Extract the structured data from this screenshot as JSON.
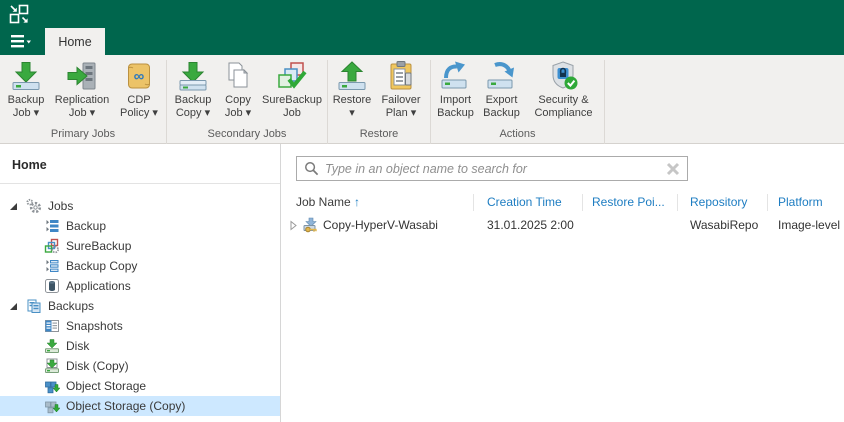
{
  "titlebar": {
    "logo_icon": "veeam-console-logo"
  },
  "tabs": {
    "menu_icon": "hamburger-menu-icon",
    "active_tab": "Home"
  },
  "ribbon": {
    "groups": [
      {
        "label": "Primary Jobs",
        "buttons": [
          {
            "icon": "backup-job-icon",
            "line1": "Backup",
            "line2": "Job ▾"
          },
          {
            "icon": "replication-job-icon",
            "line1": "Replication",
            "line2": "Job ▾"
          },
          {
            "icon": "cdp-policy-icon",
            "line1": "CDP",
            "line2": "Policy ▾"
          }
        ]
      },
      {
        "label": "Secondary Jobs",
        "buttons": [
          {
            "icon": "backup-copy-icon",
            "line1": "Backup",
            "line2": "Copy ▾"
          },
          {
            "icon": "copy-job-icon",
            "line1": "Copy",
            "line2": "Job ▾"
          },
          {
            "icon": "surebackup-job-icon",
            "line1": "SureBackup",
            "line2": "Job"
          }
        ]
      },
      {
        "label": "Restore",
        "buttons": [
          {
            "icon": "restore-icon",
            "line1": "Restore",
            "line2": "▾"
          },
          {
            "icon": "failover-plan-icon",
            "line1": "Failover",
            "line2": "Plan ▾"
          }
        ]
      },
      {
        "label": "Actions",
        "buttons": [
          {
            "icon": "import-backup-icon",
            "line1": "Import",
            "line2": "Backup"
          },
          {
            "icon": "export-backup-icon",
            "line1": "Export",
            "line2": "Backup"
          },
          {
            "icon": "security-compliance-icon",
            "line1": "Security &",
            "line2": "Compliance"
          }
        ]
      }
    ]
  },
  "sidebar": {
    "header": "Home",
    "tree": [
      {
        "label": "Jobs",
        "icon": "jobs-icon",
        "level": 0,
        "expanded": true
      },
      {
        "label": "Backup",
        "icon": "backup-tree-icon",
        "level": 1
      },
      {
        "label": "SureBackup",
        "icon": "surebackup-tree-icon",
        "level": 1
      },
      {
        "label": "Backup Copy",
        "icon": "backup-copy-tree-icon",
        "level": 1
      },
      {
        "label": "Applications",
        "icon": "applications-icon",
        "level": 1
      },
      {
        "label": "Backups",
        "icon": "backups-icon",
        "level": 0,
        "expanded": true
      },
      {
        "label": "Snapshots",
        "icon": "snapshots-icon",
        "level": 1
      },
      {
        "label": "Disk",
        "icon": "disk-icon",
        "level": 1
      },
      {
        "label": "Disk (Copy)",
        "icon": "disk-copy-icon",
        "level": 1
      },
      {
        "label": "Object Storage",
        "icon": "object-storage-icon",
        "level": 1
      },
      {
        "label": "Object Storage (Copy)",
        "icon": "object-storage-copy-icon",
        "level": 1,
        "selected": true
      }
    ]
  },
  "main": {
    "search": {
      "placeholder": "Type in an object name to search for",
      "icon": "search-icon",
      "clear_icon": "clear-icon",
      "value": ""
    },
    "table": {
      "columns": [
        {
          "label": "Job Name",
          "sort": "asc",
          "sort_glyph": "↑"
        },
        {
          "label": "Creation Time"
        },
        {
          "label": "Restore Poi..."
        },
        {
          "label": "Repository"
        },
        {
          "label": "Platform"
        }
      ],
      "rows": [
        {
          "icon": "backup-copy-job-icon",
          "job_name": "Copy-HyperV-Wasabi",
          "creation_time": "31.01.2025 2:00",
          "restore_points": "",
          "repository": "WasabiRepo",
          "platform": "Image-level"
        }
      ]
    }
  },
  "colors": {
    "brand_green": "#00664d",
    "link_blue": "#1e7dc2",
    "selection_blue": "#cde8ff",
    "ribbon_bg": "#f1f0ee"
  }
}
